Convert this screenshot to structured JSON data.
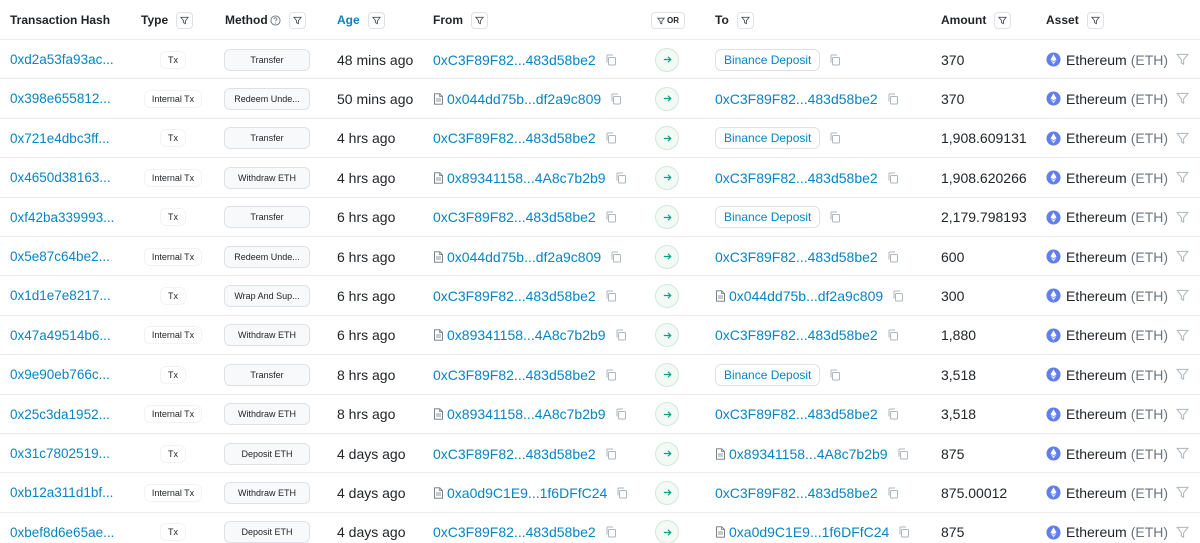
{
  "header": {
    "tx_hash": "Transaction Hash",
    "type": "Type",
    "method": "Method",
    "age": "Age",
    "from": "From",
    "or": "OR",
    "to": "To",
    "amount": "Amount",
    "asset": "Asset"
  },
  "colors": {
    "link": "#0784c3",
    "text": "#212529",
    "border": "#dee2e6",
    "eth": "#627eea"
  },
  "icons": {
    "filter": "filter-icon",
    "copy": "copy-icon",
    "contract": "contract-doc-icon",
    "transfer_arrow": "arrow-right-icon",
    "asset": "ethereum-logo-icon",
    "help": "question-circle-icon"
  },
  "rows": [
    {
      "hash": "0xd2a53fa93ac...",
      "type": "Tx",
      "method": "Transfer",
      "age": "48 mins ago",
      "from": "0xC3F89F82...483d58be2",
      "from_contract": false,
      "to": "Binance Deposit",
      "to_kind": "label",
      "amount": "370",
      "asset": "Ethereum",
      "symbol": "(ETH)"
    },
    {
      "hash": "0x398e655812...",
      "type": "Internal Tx",
      "method": "Redeem Unde...",
      "age": "50 mins ago",
      "from": "0x044dd75b...df2a9c809",
      "from_contract": true,
      "to": "0xC3F89F82...483d58be2",
      "to_kind": "address",
      "amount": "370",
      "asset": "Ethereum",
      "symbol": "(ETH)"
    },
    {
      "hash": "0x721e4dbc3ff...",
      "type": "Tx",
      "method": "Transfer",
      "age": "4 hrs ago",
      "from": "0xC3F89F82...483d58be2",
      "from_contract": false,
      "to": "Binance Deposit",
      "to_kind": "label",
      "amount": "1,908.609131",
      "asset": "Ethereum",
      "symbol": "(ETH)"
    },
    {
      "hash": "0x4650d38163...",
      "type": "Internal Tx",
      "method": "Withdraw ETH",
      "age": "4 hrs ago",
      "from": "0x89341158...4A8c7b2b9",
      "from_contract": true,
      "to": "0xC3F89F82...483d58be2",
      "to_kind": "address",
      "amount": "1,908.620266",
      "asset": "Ethereum",
      "symbol": "(ETH)"
    },
    {
      "hash": "0xf42ba339993...",
      "type": "Tx",
      "method": "Transfer",
      "age": "6 hrs ago",
      "from": "0xC3F89F82...483d58be2",
      "from_contract": false,
      "to": "Binance Deposit",
      "to_kind": "label",
      "amount": "2,179.798193",
      "asset": "Ethereum",
      "symbol": "(ETH)"
    },
    {
      "hash": "0x5e87c64be2...",
      "type": "Internal Tx",
      "method": "Redeem Unde...",
      "age": "6 hrs ago",
      "from": "0x044dd75b...df2a9c809",
      "from_contract": true,
      "to": "0xC3F89F82...483d58be2",
      "to_kind": "address",
      "amount": "600",
      "asset": "Ethereum",
      "symbol": "(ETH)"
    },
    {
      "hash": "0x1d1e7e8217...",
      "type": "Tx",
      "method": "Wrap And Sup...",
      "age": "6 hrs ago",
      "from": "0xC3F89F82...483d58be2",
      "from_contract": false,
      "to": "0x044dd75b...df2a9c809",
      "to_kind": "contract",
      "amount": "300",
      "asset": "Ethereum",
      "symbol": "(ETH)"
    },
    {
      "hash": "0x47a49514b6...",
      "type": "Internal Tx",
      "method": "Withdraw ETH",
      "age": "6 hrs ago",
      "from": "0x89341158...4A8c7b2b9",
      "from_contract": true,
      "to": "0xC3F89F82...483d58be2",
      "to_kind": "address",
      "amount": "1,880",
      "asset": "Ethereum",
      "symbol": "(ETH)"
    },
    {
      "hash": "0x9e90eb766c...",
      "type": "Tx",
      "method": "Transfer",
      "age": "8 hrs ago",
      "from": "0xC3F89F82...483d58be2",
      "from_contract": false,
      "to": "Binance Deposit",
      "to_kind": "label",
      "amount": "3,518",
      "asset": "Ethereum",
      "symbol": "(ETH)"
    },
    {
      "hash": "0x25c3da1952...",
      "type": "Internal Tx",
      "method": "Withdraw ETH",
      "age": "8 hrs ago",
      "from": "0x89341158...4A8c7b2b9",
      "from_contract": true,
      "to": "0xC3F89F82...483d58be2",
      "to_kind": "address",
      "amount": "3,518",
      "asset": "Ethereum",
      "symbol": "(ETH)"
    },
    {
      "hash": "0x31c7802519...",
      "type": "Tx",
      "method": "Deposit ETH",
      "age": "4 days ago",
      "from": "0xC3F89F82...483d58be2",
      "from_contract": false,
      "to": "0x89341158...4A8c7b2b9",
      "to_kind": "contract",
      "amount": "875",
      "asset": "Ethereum",
      "symbol": "(ETH)"
    },
    {
      "hash": "0xb12a311d1bf...",
      "type": "Internal Tx",
      "method": "Withdraw ETH",
      "age": "4 days ago",
      "from": "0xa0d9C1E9...1f6DFfC24",
      "from_contract": true,
      "to": "0xC3F89F82...483d58be2",
      "to_kind": "address",
      "amount": "875.00012",
      "asset": "Ethereum",
      "symbol": "(ETH)"
    },
    {
      "hash": "0xbef8d6e65ae...",
      "type": "Tx",
      "method": "Deposit ETH",
      "age": "4 days ago",
      "from": "0xC3F89F82...483d58be2",
      "from_contract": false,
      "to": "0xa0d9C1E9...1f6DFfC24",
      "to_kind": "contract",
      "amount": "875",
      "asset": "Ethereum",
      "symbol": "(ETH)"
    }
  ]
}
